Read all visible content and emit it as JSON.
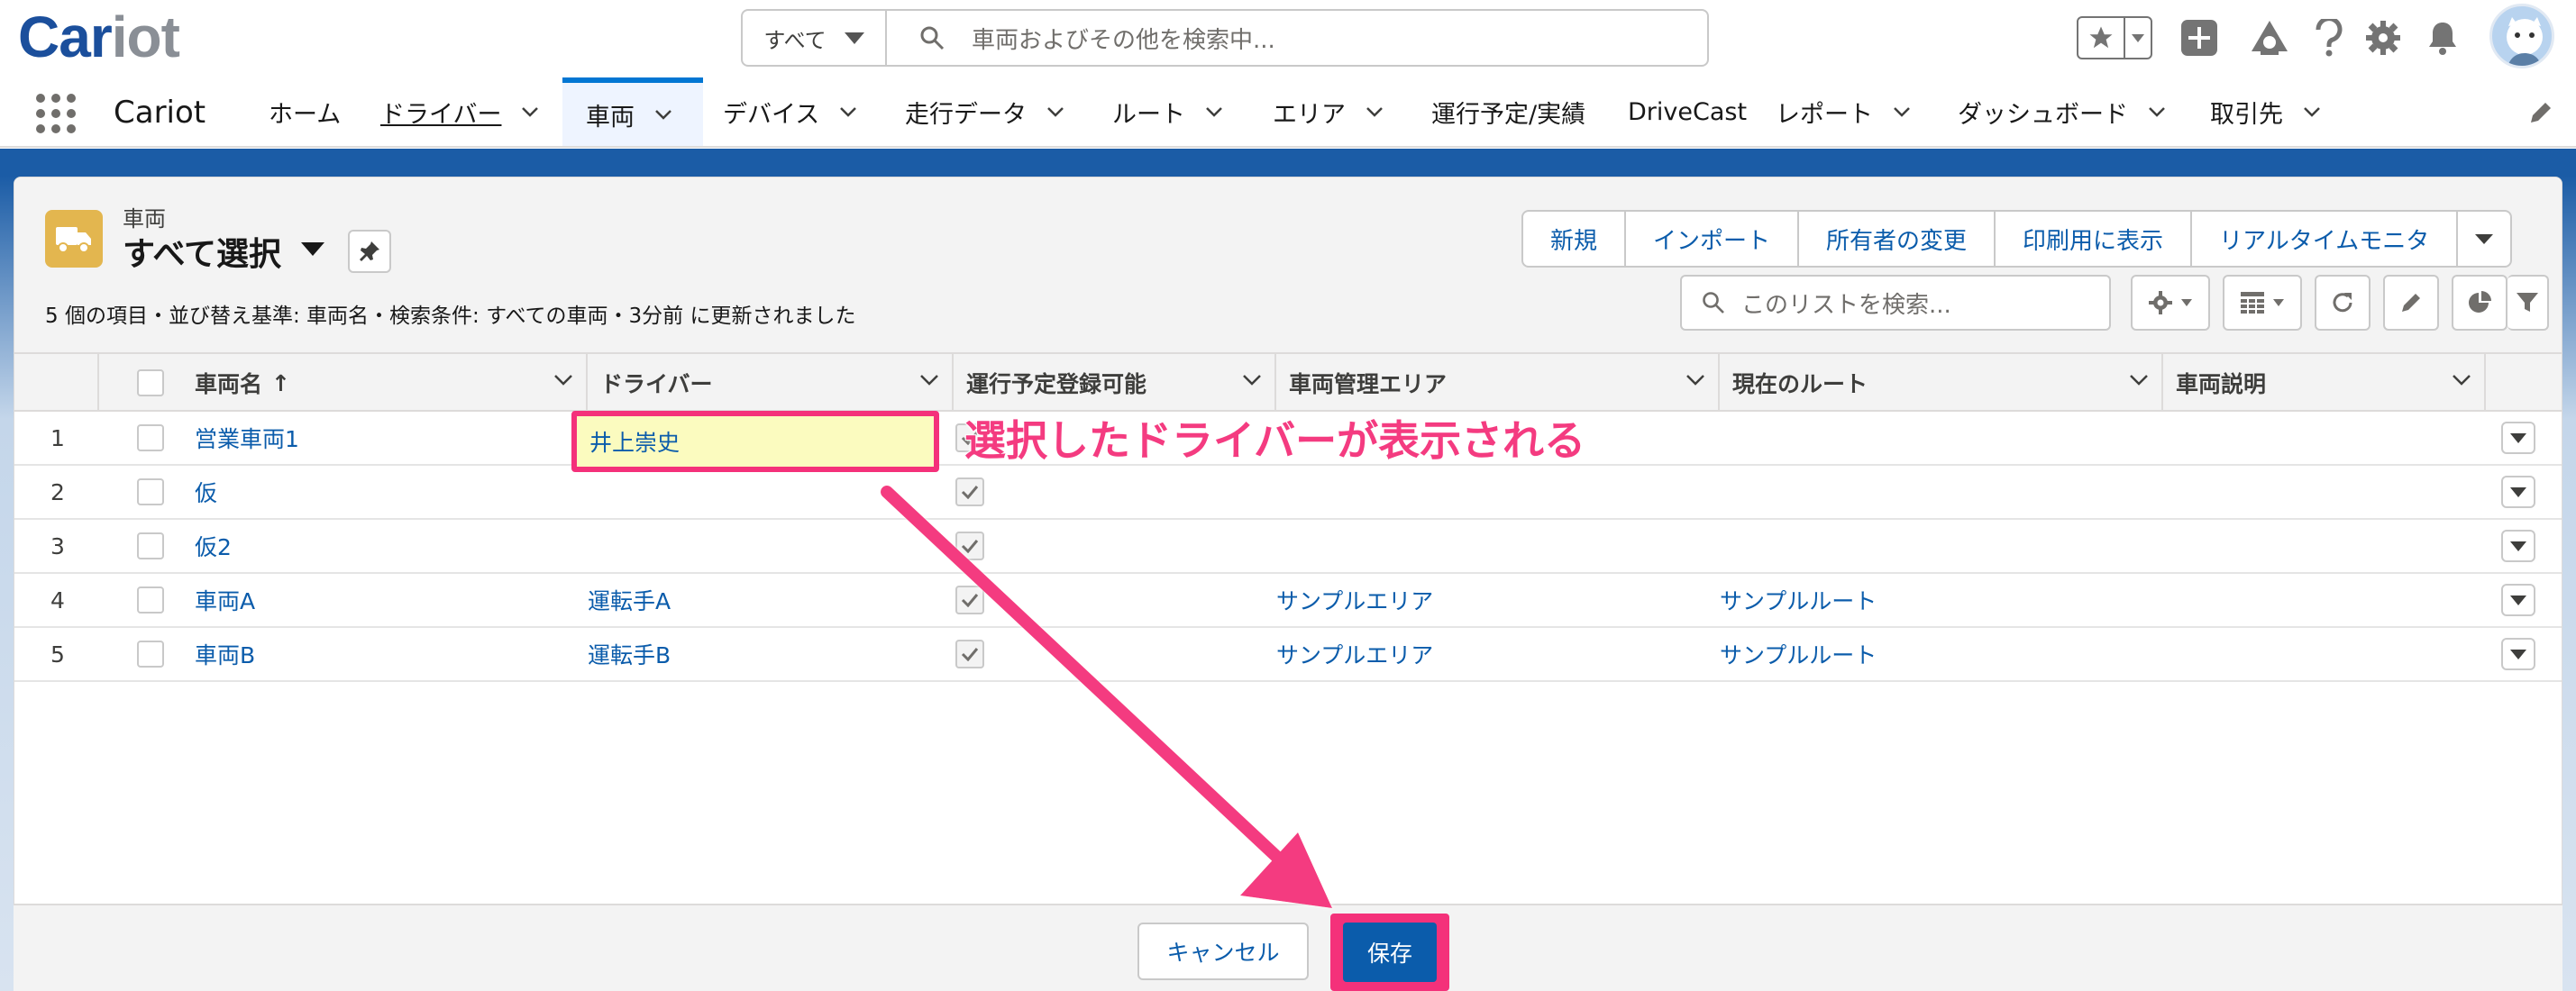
{
  "header": {
    "logo_main": "Car",
    "logo_accent": "iot",
    "search_scope": "すべて",
    "search_placeholder": "車両およびその他を検索中..."
  },
  "nav": {
    "app_name": "Cariot",
    "items": [
      {
        "label": "ホーム"
      },
      {
        "label": "ドライバー"
      },
      {
        "label": "車両"
      },
      {
        "label": "デバイス"
      },
      {
        "label": "走行データ"
      },
      {
        "label": "ルート"
      },
      {
        "label": "エリア"
      },
      {
        "label": "運行予定/実績"
      },
      {
        "label": "DriveCast"
      },
      {
        "label": "レポート"
      },
      {
        "label": "ダッシュボード"
      },
      {
        "label": "取引先"
      }
    ]
  },
  "list": {
    "object_type": "車両",
    "title": "すべて選択",
    "info": "5 個の項目・並び替え基準: 車両名・検索条件: すべての車両・3分前 に更新されました",
    "actions": [
      "新規",
      "インポート",
      "所有者の変更",
      "印刷用に表示",
      "リアルタイムモニタ"
    ],
    "search_placeholder": "このリストを検索..."
  },
  "table": {
    "columns": [
      "車両名",
      "ドライバー",
      "運行予定登録可能",
      "車両管理エリア",
      "現在のルート",
      "車両説明"
    ],
    "sort_indicator": "↑",
    "rows": [
      {
        "num": "1",
        "name": "営業車両1",
        "driver": "井上崇史",
        "schedulable": true,
        "area": "",
        "route": "",
        "desc": ""
      },
      {
        "num": "2",
        "name": "仮",
        "driver": "",
        "schedulable": true,
        "area": "",
        "route": "",
        "desc": ""
      },
      {
        "num": "3",
        "name": "仮2",
        "driver": "",
        "schedulable": true,
        "area": "",
        "route": "",
        "desc": ""
      },
      {
        "num": "4",
        "name": "車両A",
        "driver": "運転手A",
        "schedulable": true,
        "area": "サンプルエリア",
        "route": "サンプルルート",
        "desc": ""
      },
      {
        "num": "5",
        "name": "車両B",
        "driver": "運転手B",
        "schedulable": true,
        "area": "サンプルエリア",
        "route": "サンプルルート",
        "desc": ""
      }
    ]
  },
  "annotation": "選択したドライバーが表示される",
  "footer": {
    "cancel_label": "キャンセル",
    "save_label": "保存"
  },
  "colors": {
    "brand_blue": "#1b4f9c",
    "link_blue": "#0b5cab",
    "highlight_pink": "#f4317a",
    "edited_cell_bg": "#fbfbbf"
  }
}
